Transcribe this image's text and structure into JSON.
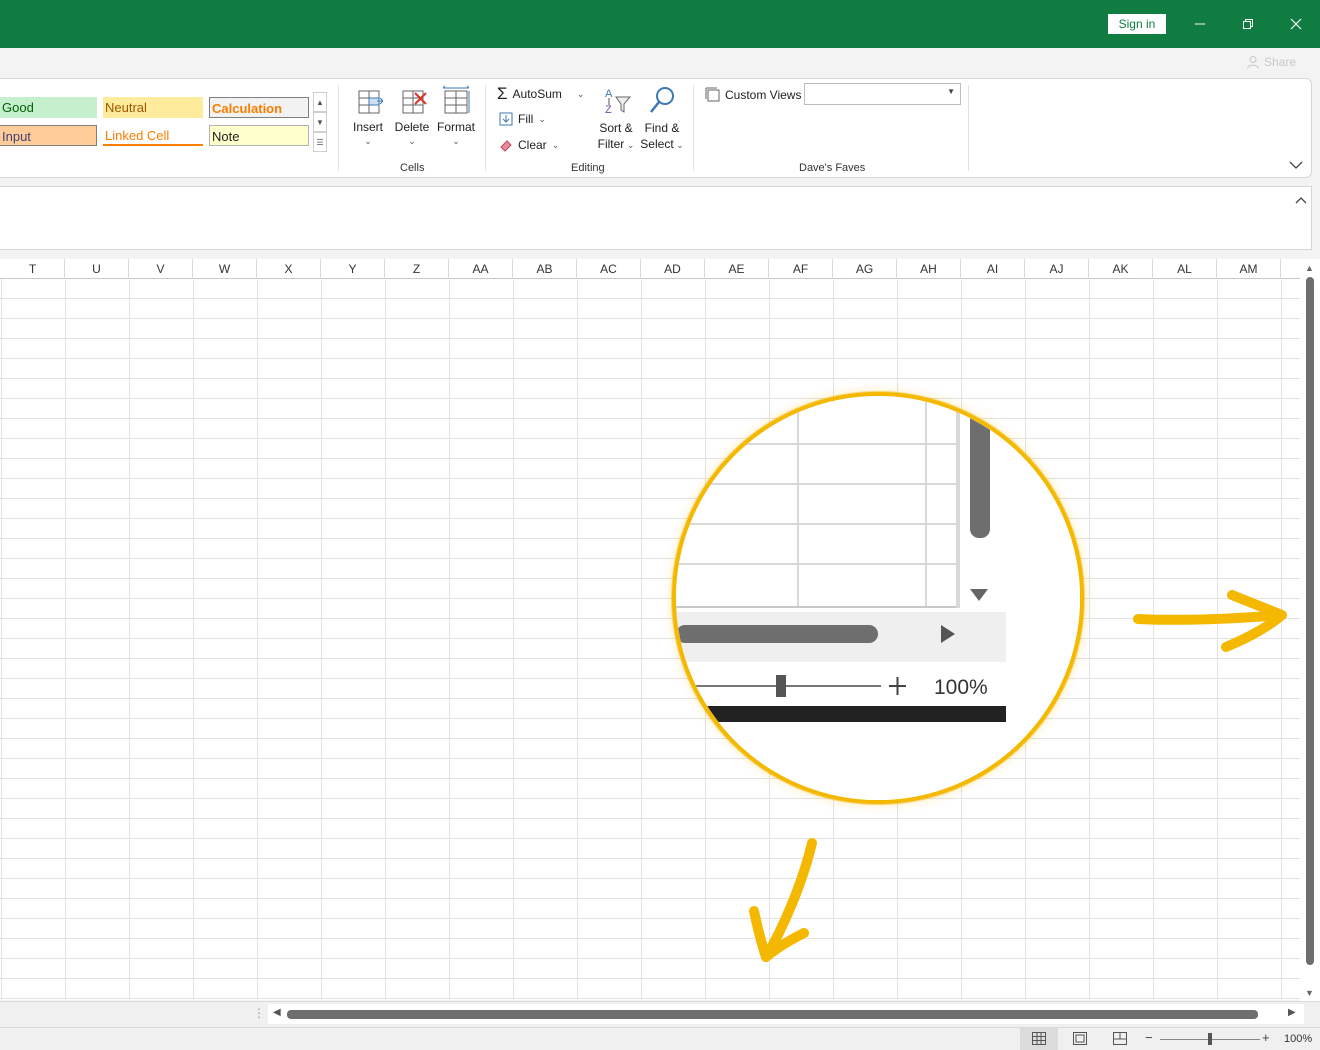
{
  "titlebar": {
    "sign_in_label": "Sign in",
    "minimize_icon": "minimize-icon",
    "restore_icon": "restore-icon",
    "close_icon": "close-icon",
    "share_label": "Share"
  },
  "ribbon": {
    "styles": {
      "good": "Good",
      "neutral": "Neutral",
      "calculation": "Calculation",
      "input": "Input",
      "linked_cell": "Linked Cell",
      "note": "Note"
    },
    "cells": {
      "label": "Cells",
      "insert": "Insert",
      "delete": "Delete",
      "format": "Format"
    },
    "editing": {
      "label": "Editing",
      "autosum": "AutoSum",
      "fill": "Fill",
      "clear": "Clear",
      "sort_filter_line1": "Sort &",
      "sort_filter_line2": "Filter",
      "find_select_line1": "Find &",
      "find_select_line2": "Select"
    },
    "daves_faves": {
      "label": "Dave's Faves",
      "custom_views": "Custom Views",
      "custom_views_value": ""
    }
  },
  "grid": {
    "columns": [
      "T",
      "U",
      "V",
      "W",
      "X",
      "Y",
      "Z",
      "AA",
      "AB",
      "AC",
      "AD",
      "AE",
      "AF",
      "AG",
      "AH",
      "AI",
      "AJ",
      "AK",
      "AL",
      "AM"
    ]
  },
  "statusbar": {
    "zoom_minus": "−",
    "zoom_plus": "+",
    "zoom_level": "100%",
    "zoom_fraction": 0.5
  },
  "annotation": {
    "magnified_zoom": "100%",
    "highlight_color": "#f5b800"
  },
  "colors": {
    "title_green": "#107c41",
    "good_fill": "#c6efce",
    "good_text": "#006100",
    "neutral_fill": "#ffeb9c",
    "neutral_text": "#9c5700",
    "calculation_fill": "#f2f2f2",
    "calculation_text": "#fa7d00",
    "input_fill": "#ffcc99",
    "input_text": "#3f3f76",
    "linked_text": "#fa7d00",
    "note_fill": "#ffffcc"
  }
}
